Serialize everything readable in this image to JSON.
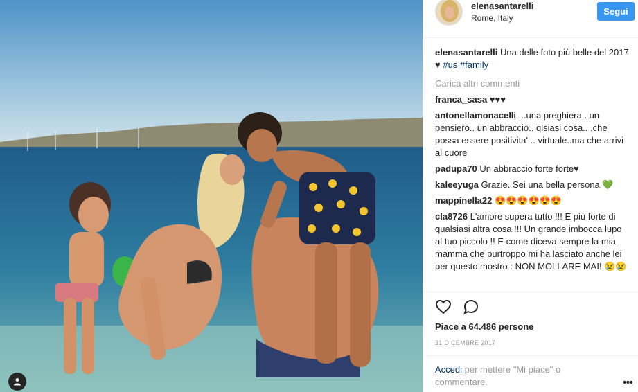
{
  "post": {
    "username": "elenasantarelli",
    "location": "Rome, Italy",
    "follow_label": "Segui"
  },
  "caption": {
    "user": "elenasantarelli",
    "text": "Una delle foto più belle del 2017 ♥ ",
    "tag1": "#us",
    "tag2": "#family"
  },
  "load_more": "Carica altri commenti",
  "comments": [
    {
      "user": "franca_sasa",
      "text": "♥♥♥"
    },
    {
      "user": "antonellamonacelli",
      "text": "...una preghiera.. un pensiero.. un abbraccio.. qlsiasi cosa.. .che possa essere positivita' .. virtuale..ma che arrivi al cuore"
    },
    {
      "user": "padupa70",
      "text": "Un abbraccio forte forte♥"
    },
    {
      "user": "kaleeyuga",
      "text": "Grazie. Sei una bella persona 💚"
    },
    {
      "user": "mappinella22",
      "text": "😍😍😍😍😍😍"
    },
    {
      "user": "cla8726",
      "text": "L'amore supera tutto !!! E più forte di qualsiasi altra cosa !!! Un grande imbocca lupo al tuo piccolo !! E come diceva sempre la mia mamma che purtroppo mi ha lasciato anche lei per questo mostro : NON MOLLARE MAI! 😢😢"
    }
  ],
  "likes": "Piace a 64.486 persone",
  "date": "31 DICEMBRE 2017",
  "login": {
    "link": "Accedi",
    "text": " per mettere \"Mi piace\" o commentare."
  },
  "icons": {
    "like": "heart-icon",
    "comment": "comment-icon",
    "tag": "user-tag-icon",
    "more": "more-options-icon"
  },
  "colors": {
    "accent": "#3897f0",
    "hashtag": "#003569",
    "muted": "#999999"
  }
}
